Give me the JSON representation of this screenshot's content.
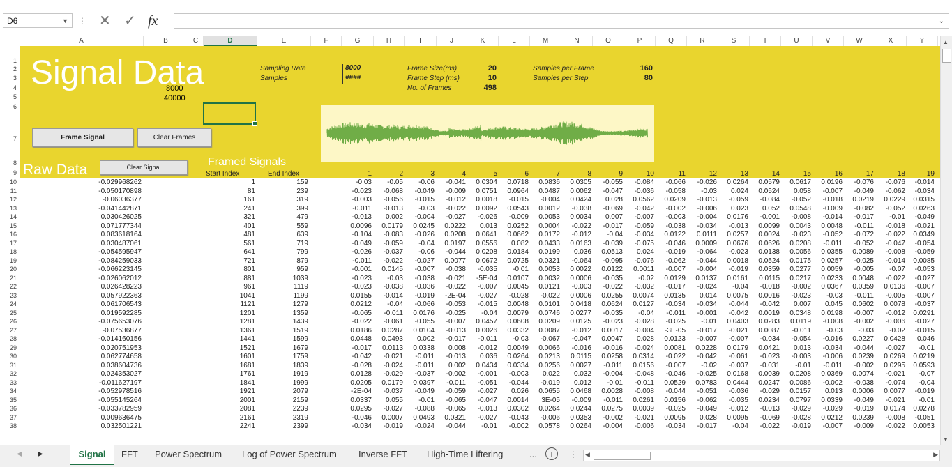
{
  "formula_bar": {
    "name_box": "D6",
    "fx_label": "fx",
    "formula": ""
  },
  "columns": [
    "A",
    "B",
    "C",
    "D",
    "E",
    "F",
    "G",
    "H",
    "I",
    "J",
    "K",
    "L",
    "M",
    "N",
    "O",
    "P",
    "Q",
    "R",
    "S",
    "T",
    "U",
    "V",
    "W",
    "X",
    "Y"
  ],
  "selected_column": "D",
  "rows": [
    "1",
    "2",
    "3",
    "4",
    "5",
    "6",
    "7",
    "8",
    "9",
    "10",
    "11",
    "12",
    "13",
    "14",
    "15",
    "16",
    "17",
    "18",
    "19",
    "20",
    "21",
    "22",
    "23",
    "24",
    "25",
    "26",
    "27",
    "28",
    "29",
    "30",
    "31",
    "32",
    "33",
    "34",
    "35",
    "36",
    "37",
    "38"
  ],
  "header": {
    "title": "Signal Data",
    "b4": "8000",
    "b5": "40000",
    "sampling_rate_label": "Sampling Rate",
    "samples_label": "Samples",
    "sampling_rate_value": "8000",
    "samples_value": "####",
    "frame_size_label": "Frame Size(ms)",
    "frame_step_label": "Frame Step (ms)",
    "num_frames_label": "No. of Frames",
    "frame_size_value": "20",
    "frame_step_value": "10",
    "num_frames_value": "498",
    "spf_label": "Samples per Frame",
    "sps_label": "Samples per Step",
    "spf_value": "160",
    "sps_value": "80"
  },
  "buttons": {
    "frame_signal": "Frame Signal",
    "clear_frames": "Clear Frames",
    "clear_signal": "Clear Signal"
  },
  "labels": {
    "raw_data": "Raw Data",
    "framed_signals": "Framed Signals",
    "start_index": "Start Index",
    "end_index": "End Index"
  },
  "frame_numbers": [
    "1",
    "2",
    "3",
    "4",
    "5",
    "6",
    "7",
    "8",
    "9",
    "10",
    "11",
    "12",
    "13",
    "14",
    "15",
    "16",
    "17",
    "18",
    "19"
  ],
  "data_rows": [
    {
      "a": "-0.029968262",
      "d": "1",
      "e": "159",
      "v": [
        "-0.03",
        "-0.05",
        "-0.06",
        "-0.041",
        "0.0304",
        "0.0718",
        "0.0836",
        "0.0305",
        "-0.055",
        "-0.084",
        "-0.066",
        "-0.026",
        "0.0264",
        "0.0579",
        "0.0617",
        "0.0196",
        "-0.076",
        "-0.076",
        "-0.014"
      ]
    },
    {
      "a": "-0.050170898",
      "d": "81",
      "e": "239",
      "v": [
        "-0.023",
        "-0.068",
        "-0.049",
        "-0.009",
        "0.0751",
        "0.0964",
        "0.0487",
        "0.0062",
        "-0.047",
        "-0.036",
        "-0.058",
        "-0.03",
        "0.024",
        "0.0524",
        "0.058",
        "-0.007",
        "-0.049",
        "-0.062",
        "-0.034"
      ]
    },
    {
      "a": "-0.06036377",
      "d": "161",
      "e": "319",
      "v": [
        "-0.003",
        "-0.056",
        "-0.015",
        "-0.012",
        "0.0018",
        "-0.015",
        "-0.004",
        "0.0424",
        "0.028",
        "0.0562",
        "0.0209",
        "-0.013",
        "-0.059",
        "-0.084",
        "-0.052",
        "-0.018",
        "0.0219",
        "0.0229",
        "0.0315"
      ]
    },
    {
      "a": "-0.041442871",
      "d": "241",
      "e": "399",
      "v": [
        "-0.011",
        "-0.013",
        "-0.03",
        "-0.022",
        "0.0092",
        "0.0543",
        "0.0012",
        "-0.038",
        "-0.069",
        "-0.042",
        "-0.002",
        "-0.006",
        "0.023",
        "0.052",
        "0.0548",
        "-0.009",
        "-0.082",
        "-0.052",
        "0.0263"
      ]
    },
    {
      "a": "0.030426025",
      "d": "321",
      "e": "479",
      "v": [
        "-0.013",
        "0.002",
        "-0.004",
        "-0.027",
        "-0.026",
        "-0.009",
        "0.0053",
        "0.0034",
        "0.007",
        "-0.007",
        "-0.003",
        "-0.004",
        "0.0176",
        "-0.001",
        "-0.008",
        "-0.014",
        "-0.017",
        "-0.01",
        "-0.049"
      ]
    },
    {
      "a": "0.071777344",
      "d": "401",
      "e": "559",
      "v": [
        "0.0096",
        "0.0179",
        "0.0245",
        "0.0222",
        "0.013",
        "0.0252",
        "0.0004",
        "-0.022",
        "-0.017",
        "-0.059",
        "-0.038",
        "-0.034",
        "-0.013",
        "0.0099",
        "0.0043",
        "0.0048",
        "-0.011",
        "-0.018",
        "-0.021"
      ]
    },
    {
      "a": "0.083618164",
      "d": "481",
      "e": "639",
      "v": [
        "-0.104",
        "-0.083",
        "-0.026",
        "0.0208",
        "0.0641",
        "0.0662",
        "0.0172",
        "-0.012",
        "-0.04",
        "-0.034",
        "0.0122",
        "0.0111",
        "0.0257",
        "0.0024",
        "-0.023",
        "-0.052",
        "-0.072",
        "-0.022",
        "0.0349"
      ]
    },
    {
      "a": "0.030487061",
      "d": "561",
      "e": "719",
      "v": [
        "-0.049",
        "-0.059",
        "-0.04",
        "0.0197",
        "0.0556",
        "0.082",
        "0.0433",
        "0.0163",
        "-0.039",
        "-0.075",
        "-0.046",
        "0.0009",
        "0.0676",
        "0.0626",
        "0.0208",
        "-0.011",
        "-0.052",
        "-0.047",
        "-0.054"
      ]
    },
    {
      "a": "-0.054595947",
      "d": "641",
      "e": "799",
      "v": [
        "-0.026",
        "-0.037",
        "-0.06",
        "-0.044",
        "0.0208",
        "0.0184",
        "0.0199",
        "0.036",
        "0.0513",
        "0.024",
        "-0.019",
        "-0.064",
        "-0.023",
        "0.0138",
        "0.0056",
        "0.0355",
        "0.0089",
        "-0.008",
        "-0.059"
      ]
    },
    {
      "a": "-0.084259033",
      "d": "721",
      "e": "879",
      "v": [
        "-0.011",
        "-0.022",
        "-0.027",
        "0.0077",
        "0.0672",
        "0.0725",
        "0.0321",
        "-0.064",
        "-0.095",
        "-0.076",
        "-0.062",
        "-0.044",
        "0.0018",
        "0.0524",
        "0.0175",
        "0.0257",
        "-0.025",
        "-0.014",
        "0.0085"
      ]
    },
    {
      "a": "-0.066223145",
      "d": "801",
      "e": "959",
      "v": [
        "-0.001",
        "0.0145",
        "-0.007",
        "-0.038",
        "-0.035",
        "-0.01",
        "0.0053",
        "0.0022",
        "0.0122",
        "0.0011",
        "-0.007",
        "-0.004",
        "-0.019",
        "0.0359",
        "0.0277",
        "0.0059",
        "-0.005",
        "-0.07",
        "-0.053"
      ]
    },
    {
      "a": "-0.026062012",
      "d": "881",
      "e": "1039",
      "v": [
        "-0.023",
        "-0.03",
        "-0.038",
        "-0.021",
        "-5E-04",
        "0.0107",
        "0.0032",
        "0.0006",
        "-0.035",
        "-0.02",
        "0.0129",
        "0.0137",
        "0.0161",
        "0.0115",
        "0.0217",
        "0.0233",
        "0.0048",
        "-0.022",
        "-0.027"
      ]
    },
    {
      "a": "0.026428223",
      "d": "961",
      "e": "1119",
      "v": [
        "-0.023",
        "-0.038",
        "-0.036",
        "-0.022",
        "-0.007",
        "0.0045",
        "0.0121",
        "-0.003",
        "-0.022",
        "-0.032",
        "-0.017",
        "-0.024",
        "-0.04",
        "-0.018",
        "-0.002",
        "0.0367",
        "0.0359",
        "0.0136",
        "-0.007"
      ]
    },
    {
      "a": "0.057922363",
      "d": "1041",
      "e": "1199",
      "v": [
        "0.0155",
        "-0.014",
        "-0.019",
        "-2E-04",
        "-0.027",
        "-0.028",
        "-0.022",
        "0.0006",
        "0.0255",
        "0.0074",
        "0.0135",
        "0.014",
        "0.0075",
        "0.0016",
        "-0.023",
        "-0.03",
        "-0.011",
        "-0.005",
        "-0.007"
      ]
    },
    {
      "a": "0.061706543",
      "d": "1121",
      "e": "1279",
      "v": [
        "0.0212",
        "-0.04",
        "-0.066",
        "-0.053",
        "-0.015",
        "0.0048",
        "0.0101",
        "0.0418",
        "0.0624",
        "0.0127",
        "-0.034",
        "-0.034",
        "-0.044",
        "-0.042",
        "0.007",
        "0.045",
        "0.0602",
        "0.0078",
        "-0.037"
      ]
    },
    {
      "a": "0.019592285",
      "d": "1201",
      "e": "1359",
      "v": [
        "-0.065",
        "-0.011",
        "0.0176",
        "-0.025",
        "-0.04",
        "0.0079",
        "0.0746",
        "0.0277",
        "-0.035",
        "-0.04",
        "-0.011",
        "-0.001",
        "-0.042",
        "0.0019",
        "0.0348",
        "0.0198",
        "-0.007",
        "-0.012",
        "0.0291"
      ]
    },
    {
      "a": "-0.075653076",
      "d": "1281",
      "e": "1439",
      "v": [
        "-0.022",
        "-0.061",
        "-0.055",
        "-0.007",
        "0.0457",
        "0.0608",
        "0.0209",
        "0.0125",
        "-0.023",
        "-0.028",
        "-0.025",
        "-0.01",
        "0.0403",
        "0.0283",
        "0.0119",
        "-0.008",
        "-0.002",
        "-0.006",
        "-0.027"
      ]
    },
    {
      "a": "-0.07536877",
      "d": "1361",
      "e": "1519",
      "v": [
        "0.0186",
        "0.0287",
        "0.0104",
        "-0.013",
        "0.0026",
        "0.0332",
        "0.0087",
        "-0.012",
        "0.0017",
        "-0.004",
        "-3E-05",
        "-0.017",
        "-0.021",
        "0.0087",
        "-0.011",
        "-0.03",
        "-0.03",
        "-0.02",
        "-0.015"
      ]
    },
    {
      "a": "-0.014160156",
      "d": "1441",
      "e": "1599",
      "v": [
        "0.0448",
        "0.0493",
        "0.002",
        "-0.017",
        "-0.011",
        "-0.03",
        "-0.067",
        "-0.047",
        "0.0047",
        "0.028",
        "0.0123",
        "-0.007",
        "-0.007",
        "-0.034",
        "-0.054",
        "-0.016",
        "0.0227",
        "0.0428",
        "0.046"
      ]
    },
    {
      "a": "0.020751953",
      "d": "1521",
      "e": "1679",
      "v": [
        "-0.017",
        "0.0113",
        "0.0338",
        "0.008",
        "-0.012",
        "0.0049",
        "0.0066",
        "-0.016",
        "-0.016",
        "-0.024",
        "0.0081",
        "0.0228",
        "0.0179",
        "0.0421",
        "0.013",
        "-0.034",
        "-0.044",
        "-0.027",
        "-0.01"
      ]
    },
    {
      "a": "0.062774658",
      "d": "1601",
      "e": "1759",
      "v": [
        "-0.042",
        "-0.021",
        "-0.011",
        "-0.013",
        "0.036",
        "0.0264",
        "0.0213",
        "0.0115",
        "0.0258",
        "0.0314",
        "-0.022",
        "-0.042",
        "-0.061",
        "-0.023",
        "-0.003",
        "-0.006",
        "0.0239",
        "0.0269",
        "0.0219"
      ]
    },
    {
      "a": "0.038604736",
      "d": "1681",
      "e": "1839",
      "v": [
        "-0.028",
        "-0.024",
        "-0.011",
        "0.002",
        "0.0434",
        "0.0334",
        "0.0256",
        "0.0027",
        "-0.011",
        "0.0156",
        "-0.007",
        "-0.02",
        "-0.037",
        "-0.031",
        "-0.01",
        "-0.011",
        "-0.002",
        "0.0295",
        "0.0593"
      ]
    },
    {
      "a": "0.024353027",
      "d": "1761",
      "e": "1919",
      "v": [
        "0.0128",
        "-0.029",
        "-0.037",
        "-0.002",
        "-0.001",
        "-0.003",
        "0.022",
        "0.032",
        "-0.004",
        "-0.048",
        "-0.046",
        "-0.025",
        "0.0168",
        "0.0039",
        "0.0208",
        "0.0369",
        "0.0074",
        "-0.021",
        "-0.07"
      ]
    },
    {
      "a": "-0.011627197",
      "d": "1841",
      "e": "1999",
      "v": [
        "0.0205",
        "0.0179",
        "0.0397",
        "-0.011",
        "-0.051",
        "-0.044",
        "-0.019",
        "0.012",
        "-0.01",
        "-0.011",
        "0.0529",
        "0.0783",
        "0.0444",
        "0.0247",
        "0.0086",
        "-0.002",
        "-0.038",
        "-0.074",
        "-0.04"
      ]
    },
    {
      "a": "-0.052978516",
      "d": "1921",
      "e": "2079",
      "v": [
        "-2E-04",
        "-0.037",
        "-0.049",
        "-0.059",
        "-0.027",
        "0.026",
        "0.0655",
        "0.0468",
        "0.0028",
        "-0.008",
        "-0.044",
        "-0.051",
        "-0.036",
        "-0.029",
        "0.0157",
        "0.013",
        "0.0006",
        "0.0077",
        "-0.019"
      ]
    },
    {
      "a": "-0.055145264",
      "d": "2001",
      "e": "2159",
      "v": [
        "0.0337",
        "0.055",
        "-0.01",
        "-0.065",
        "-0.047",
        "0.0014",
        "3E-05",
        "-0.009",
        "-0.011",
        "0.0261",
        "0.0156",
        "-0.062",
        "-0.035",
        "0.0234",
        "0.0797",
        "0.0339",
        "-0.049",
        "-0.021",
        "-0.01"
      ]
    },
    {
      "a": "-0.033782959",
      "d": "2081",
      "e": "2239",
      "v": [
        "0.0295",
        "-0.027",
        "-0.088",
        "-0.065",
        "-0.013",
        "0.0302",
        "0.0264",
        "0.0244",
        "0.0275",
        "0.0039",
        "-0.025",
        "-0.049",
        "-0.012",
        "-0.013",
        "-0.029",
        "-0.029",
        "-0.019",
        "0.0174",
        "0.0278"
      ]
    },
    {
      "a": "0.009636475",
      "d": "2161",
      "e": "2319",
      "v": [
        "-0.046",
        "0.0007",
        "0.0493",
        "0.0321",
        "-0.027",
        "-0.043",
        "-0.006",
        "0.0353",
        "-0.002",
        "-0.021",
        "0.0095",
        "0.028",
        "0.0095",
        "-0.069",
        "-0.028",
        "0.0212",
        "0.0239",
        "-0.008",
        "-0.051"
      ]
    },
    {
      "a": "0.032501221",
      "d": "2241",
      "e": "2399",
      "v": [
        "-0.034",
        "-0.019",
        "-0.024",
        "-0.044",
        "-0.01",
        "-0.002",
        "0.0578",
        "0.0264",
        "-0.004",
        "-0.006",
        "-0.034",
        "-0.017",
        "-0.04",
        "-0.022",
        "-0.019",
        "-0.007",
        "-0.009",
        "-0.022",
        "0.0053"
      ]
    }
  ],
  "sheet_tabs": [
    "Signal",
    "FFT",
    "Power Spectrum",
    "Log of Power Spectrum",
    "Inverse FFT",
    "High-Time Liftering",
    "..."
  ],
  "active_tab": "Signal",
  "colors": {
    "accent": "#217346",
    "banner": "#e9d52e",
    "wave": "#70ad47",
    "wave_bg": "#fdf7c6"
  }
}
